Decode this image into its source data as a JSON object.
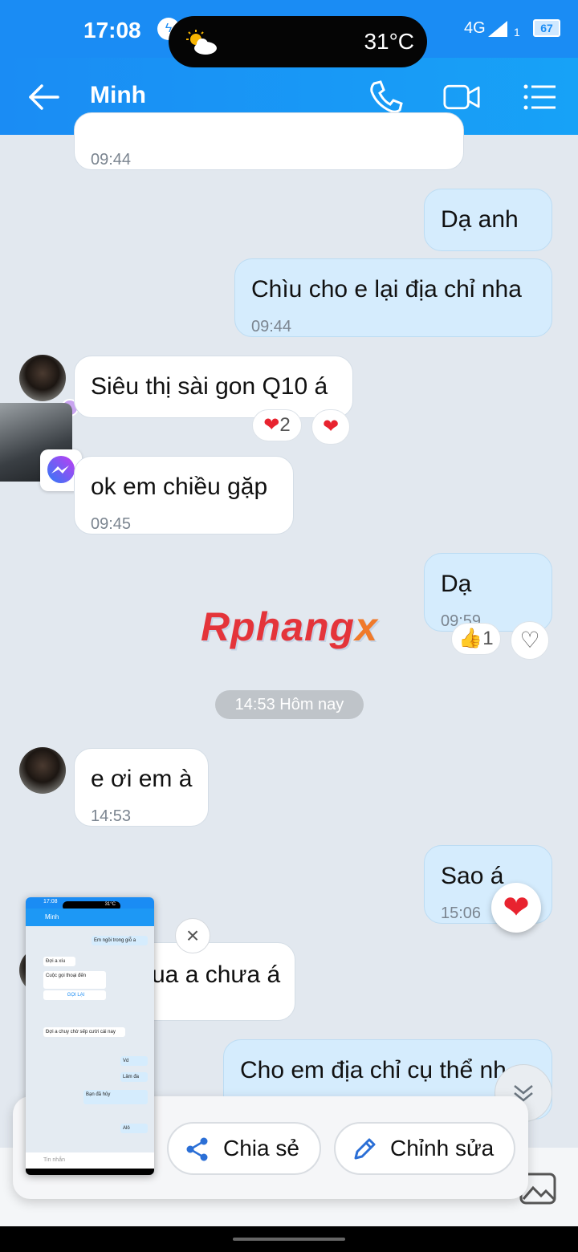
{
  "status_bar": {
    "time": "17:08",
    "temperature": "31°C",
    "network": "4G",
    "sim": "1",
    "battery": "67",
    "weather_icon": "partly-cloudy-icon"
  },
  "header": {
    "title": "Minh",
    "icons": [
      "back-arrow-icon",
      "phone-icon",
      "video-camera-icon",
      "menu-list-icon"
    ]
  },
  "messages": [
    {
      "side": "in",
      "text": "",
      "time": "09:44"
    },
    {
      "side": "out",
      "text": "Dạ anh",
      "time": ""
    },
    {
      "side": "out",
      "text": "Chìu cho e lại địa chỉ nha",
      "time": "09:44"
    },
    {
      "side": "in",
      "text": "Siêu thị sài gon Q10 á",
      "time": "",
      "reactions": [
        {
          "icon": "❤",
          "count": "2"
        },
        {
          "icon": "❤",
          "count": ""
        }
      ]
    },
    {
      "side": "in",
      "text": "ok em chiều gặp",
      "time": "09:45"
    },
    {
      "side": "out",
      "text": "Dạ",
      "time": "09:59",
      "reactions": [
        {
          "icon": "👍",
          "count": "1"
        },
        {
          "icon": "♡",
          "count": ""
        }
      ]
    },
    {
      "side": "in",
      "text": "e ơi em à",
      "time": "14:53"
    },
    {
      "side": "out",
      "text": "Sao á",
      "time": "15:06"
    },
    {
      "side": "in",
      "text": "ua a chưa á",
      "time": ""
    },
    {
      "side": "out",
      "text": "Cho em địa chỉ cụ thể nh",
      "time": ""
    }
  ],
  "date_separator": "14:53 Hôm nay",
  "watermark": {
    "main": "Rphang",
    "accent": "x"
  },
  "share_panel": {
    "share_label": "Chia sẻ",
    "edit_label": "Chỉnh sửa"
  },
  "thumbnail": {
    "time": "17:08",
    "temp": "31°C",
    "title": "Minh",
    "lines": [
      "Em ngồi trong giỗ a",
      "Đợi a xíu",
      "Cuộc gọi thoại đến",
      "GỌI LẠI",
      "Đợi a chuy chờ sếp cười cái nay",
      "Vd",
      "Lâm đa",
      "Bạn đã hủy",
      "Alô",
      "Tin nhắn"
    ]
  },
  "colors": {
    "accent": "#1a8cf4",
    "outgoing_bubble": "#d5ecfd",
    "heart": "#e8232f"
  }
}
